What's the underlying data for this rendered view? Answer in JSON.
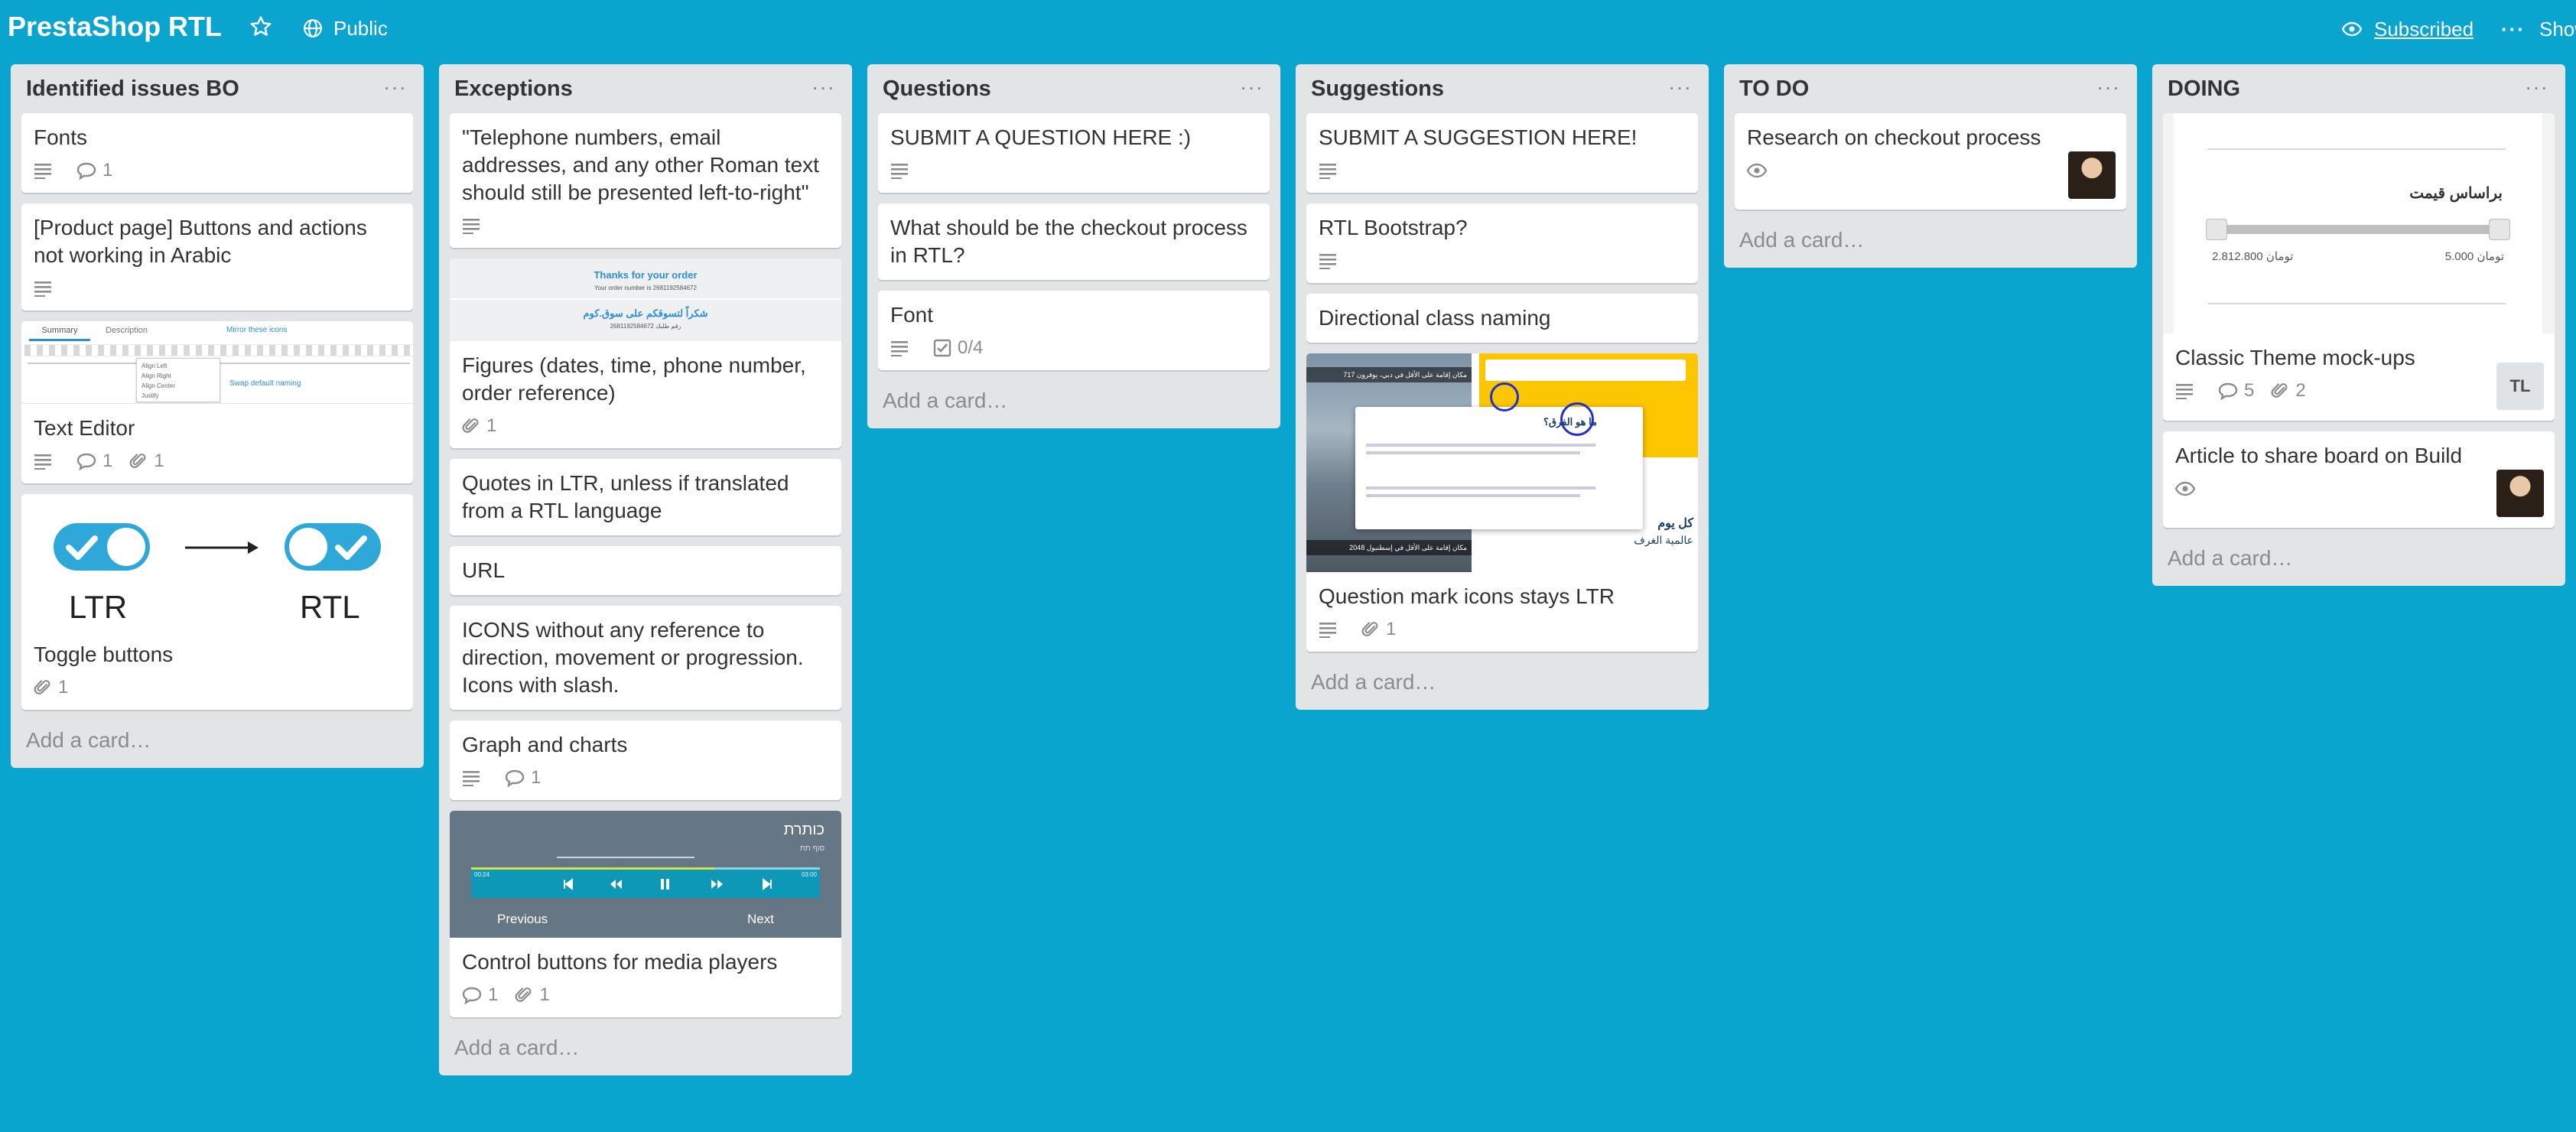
{
  "header": {
    "board_title": "PrestaShop RTL",
    "visibility": "Public",
    "subscribed": "Subscribed",
    "show_menu": "Show"
  },
  "add_card_label": "Add a card…",
  "lists": [
    {
      "title": "Identified issues BO",
      "cards": [
        {
          "title": "Fonts",
          "comments": "1"
        },
        {
          "title": "[Product page] Buttons and actions not working in Arabic"
        },
        {
          "title": "Text Editor",
          "comments": "1",
          "attachments": "1",
          "cover": {
            "tab1": "Summary",
            "tab2": "Description",
            "note1": "Mirror these icons",
            "note2": "Swap default naming",
            "menu": [
              "Align Left",
              "Align Right",
              "Align Center",
              "Justify"
            ]
          }
        },
        {
          "title": "Toggle buttons",
          "attachments": "1",
          "cover": {
            "ltr": "LTR",
            "rtl": "RTL"
          }
        }
      ]
    },
    {
      "title": "Exceptions",
      "cards": [
        {
          "title": "\"Telephone numbers, email addresses, and any other Roman text should still be presented left-to-right\""
        },
        {
          "title": "Figures (dates, time, phone number, order reference)",
          "attachments": "1",
          "cover": {
            "line1": "Thanks for your order",
            "line2": "Your order number is 2681192584672",
            "line3": "شكراً لتسوقكم على سوق.كوم",
            "line4": "2681192584672 رقم طلبك"
          }
        },
        {
          "title": "Quotes in LTR, unless if translated from a RTL language"
        },
        {
          "title": "URL"
        },
        {
          "title": "ICONS without any reference to direction, movement or progression. Icons with slash."
        },
        {
          "title": "Graph and charts",
          "comments": "1"
        },
        {
          "title": "Control buttons for media players",
          "comments": "1",
          "attachments": "1",
          "cover": {
            "heading": "כותרת",
            "sub": "סוף תת",
            "time_start": "00:24",
            "time_end": "03:00",
            "prev": "Previous",
            "next": "Next"
          }
        }
      ]
    },
    {
      "title": "Questions",
      "cards": [
        {
          "title": "SUBMIT A QUESTION HERE :)"
        },
        {
          "title": "What should be the checkout process in RTL?"
        },
        {
          "title": "Font",
          "checklist": "0/4"
        }
      ]
    },
    {
      "title": "Suggestions",
      "cards": [
        {
          "title": "SUBMIT A SUGGESTION HERE!"
        },
        {
          "title": "RTL Bootstrap?"
        },
        {
          "title": "Directional class naming"
        },
        {
          "title": "Question mark icons stays LTR",
          "attachments": "1",
          "cover": {
            "a": "717 مكان إقامة على الأقل في دبي، يوفرون",
            "b": "ما هو الفرق؟",
            "c": "2048 مكان إقامة على الأقل في إسطنبول",
            "d": "كل يوم",
            "e": "عالمية الغرف"
          }
        }
      ]
    },
    {
      "title": "TO DO",
      "cards": [
        {
          "title": "Research on checkout process"
        }
      ]
    },
    {
      "title": "DOING",
      "cards": [
        {
          "title": "Classic Theme mock-ups",
          "comments": "5",
          "attachments": "2",
          "member": "TL",
          "cover": {
            "label": "براساس قیمت",
            "min": "2.812.800 تومان",
            "max": "5.000 تومان"
          }
        },
        {
          "title": "Article to share board on Build"
        }
      ]
    }
  ],
  "colors": {
    "background": "#0aa5cf",
    "list": "#e2e4e6",
    "card": "#ffffff",
    "toggle": "#2ea8d8",
    "cover_yellow": "#fcc600"
  },
  "icons": [
    "star-icon",
    "globe-icon",
    "eye-icon",
    "description-icon",
    "comment-icon",
    "attachment-icon",
    "checklist-icon"
  ]
}
